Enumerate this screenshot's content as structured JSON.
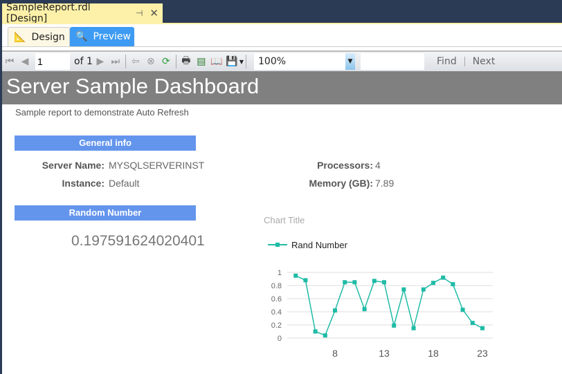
{
  "document_tab": {
    "title": "SampleReport.rdl [Design]",
    "pin_icon": "pin-icon",
    "close_icon": "close-icon"
  },
  "view_tabs": [
    {
      "label": "Design"
    },
    {
      "label": "Preview"
    }
  ],
  "toolbar": {
    "page": "1",
    "of_label": "of 1",
    "zoom": "100%",
    "find": "Find",
    "next": "Next"
  },
  "report": {
    "title": "Server Sample Dashboard",
    "subtitle": "Sample report to demonstrate Auto Refresh",
    "general_header": "General info",
    "server_label": "Server Name:",
    "server_value": "MYSQLSERVERINST",
    "instance_label": "Instance:",
    "instance_value": "Default",
    "processors_label": "Processors:",
    "processors_value": "4",
    "memory_label": "Memory (GB):",
    "memory_value": "7.89",
    "random_header": "Random Number",
    "random_value": "0.197591624020401"
  },
  "chart_data": {
    "type": "line",
    "title": "Chart Title",
    "legend": [
      "Rand Number"
    ],
    "legend_position": "top-left",
    "x": [
      4,
      5,
      6,
      7,
      8,
      9,
      10,
      11,
      12,
      13,
      14,
      15,
      16,
      17,
      18,
      19,
      20,
      21,
      22,
      23
    ],
    "series": [
      {
        "name": "Rand Number",
        "color": "#1fbba6",
        "values": [
          0.95,
          0.88,
          0.1,
          0.04,
          0.42,
          0.85,
          0.85,
          0.44,
          0.87,
          0.85,
          0.19,
          0.74,
          0.15,
          0.74,
          0.84,
          0.92,
          0.82,
          0.43,
          0.23,
          0.15
        ]
      }
    ],
    "yticks": [
      "0",
      "0.2",
      "0.4",
      "0.6",
      "0.8",
      "1"
    ],
    "xticks": [
      "8",
      "13",
      "18",
      "23"
    ],
    "ylim": [
      0,
      1
    ],
    "grid": true
  }
}
